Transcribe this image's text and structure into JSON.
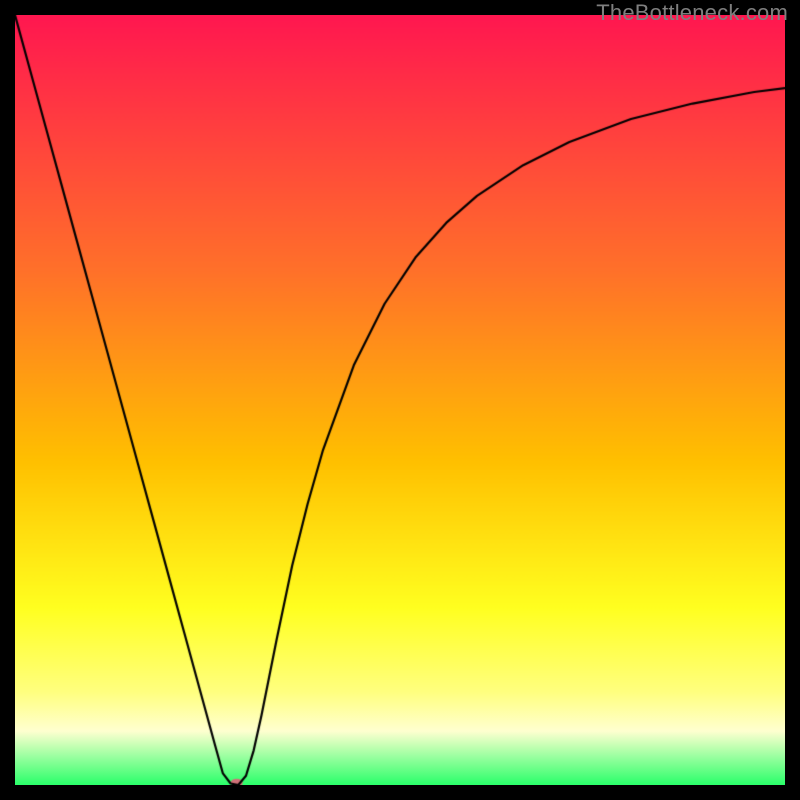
{
  "watermark": {
    "text": "TheBottleneck.com"
  },
  "chart_data": {
    "type": "line",
    "title": "",
    "xlabel": "",
    "ylabel": "",
    "xlim": [
      0,
      100
    ],
    "ylim": [
      0,
      100
    ],
    "grid": false,
    "legend": false,
    "background_gradient": {
      "top_color": "#ff1750",
      "mid_colors": [
        {
          "stop": 0.33,
          "color": "#ff702a"
        },
        {
          "stop": 0.58,
          "color": "#ffc000"
        },
        {
          "stop": 0.77,
          "color": "#ffff20"
        },
        {
          "stop": 0.88,
          "color": "#ffff80"
        },
        {
          "stop": 0.93,
          "color": "#ffffd0"
        }
      ],
      "bottom_color": "#2aff6a"
    },
    "series": [
      {
        "name": "bottleneck-curve",
        "stroke": "#000000",
        "stroke_width": 2.2,
        "x": [
          0,
          2,
          4,
          6,
          8,
          10,
          12,
          14,
          16,
          18,
          20,
          22,
          24,
          26,
          27,
          28,
          29,
          30,
          31,
          32,
          33,
          34,
          36,
          38,
          40,
          44,
          48,
          52,
          56,
          60,
          66,
          72,
          80,
          88,
          96,
          100
        ],
        "y": [
          100,
          92.7,
          85.4,
          78.1,
          70.8,
          63.5,
          56.2,
          48.9,
          41.6,
          34.3,
          27.0,
          19.7,
          12.4,
          5.1,
          1.5,
          0.2,
          0.0,
          1.2,
          4.5,
          9.0,
          14.0,
          19.0,
          28.5,
          36.5,
          43.5,
          54.5,
          62.5,
          68.5,
          73.0,
          76.5,
          80.5,
          83.5,
          86.5,
          88.5,
          90.0,
          90.5
        ]
      }
    ],
    "marker": {
      "name": "minimum-marker",
      "x": 28.8,
      "y": 0.3,
      "rx": 6,
      "ry": 4,
      "fill": "#d07078"
    }
  }
}
